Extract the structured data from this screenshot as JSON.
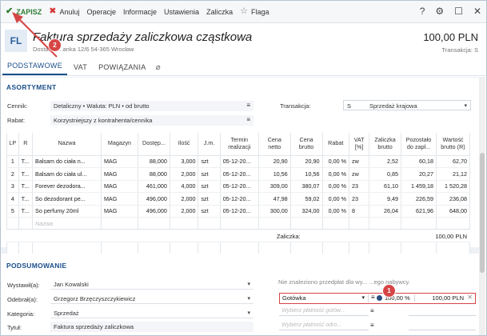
{
  "toolbar": {
    "save": "ZAPISZ",
    "cancel": "Anuluj",
    "items": [
      "Operacje",
      "Informacje",
      "Ustawienia",
      "Zaliczka"
    ],
    "flag": "Flaga",
    "right_icons": [
      "help-icon",
      "gear-icon",
      "maximize-icon",
      "close-icon"
    ]
  },
  "header": {
    "avatar": "FL",
    "title": "Faktura sprzedaży zaliczkowa cząstkowa",
    "subtitle": "Dostawa  ...anka  12/6  54-365  Wrocław",
    "amount": "100,00 PLN",
    "amount_sub": "Transakcja: S"
  },
  "tabs": [
    "PODSTAWOWE",
    "VAT",
    "POWIĄZANIA"
  ],
  "assortment": {
    "title": "ASORTYMENT",
    "cennik_label": "Cennik:",
    "cennik_value": "Detaliczny • Waluta: PLN • od brutto",
    "rabat_label": "Rabat:",
    "rabat_value": "Korzystniejszy z kontrahenta/cennika",
    "transakcja_label": "Transakcja:",
    "transakcja_code": "S",
    "transakcja_value": "Sprzedaż krajowa"
  },
  "table": {
    "headers": [
      "LP",
      "R",
      "Nazwa",
      "Magazyn",
      "Dostęp...",
      "Ilość",
      "J.m.",
      "Termin realizacji",
      "Cena netto",
      "Cena brutto",
      "Rabat",
      "VAT [%]",
      "Zaliczka brutto",
      "Pozostało do zapł...",
      "Wartość brutto (R)"
    ],
    "rows": [
      [
        "1",
        "T...",
        "Balsam do ciała n...",
        "MAG",
        "88,000",
        "3,000",
        "szt",
        "05-12-20...",
        "20,90",
        "20,90",
        "0,00 %",
        "zw",
        "2,52",
        "60,18",
        "62,70"
      ],
      [
        "2",
        "T...",
        "Balsam do ciała ul...",
        "MAG",
        "88,000",
        "2,000",
        "szt",
        "05-12-20...",
        "10,56",
        "10,56",
        "0,00 %",
        "zw",
        "0,85",
        "20,27",
        "21,12"
      ],
      [
        "3",
        "T...",
        "Forever dezodora...",
        "MAG",
        "461,000",
        "4,000",
        "szt",
        "05-12-20...",
        "309,00",
        "380,07",
        "0,00 %",
        "23",
        "61,10",
        "1 459,18",
        "1 520,28"
      ],
      [
        "4",
        "T...",
        "So dezodorant pe...",
        "MAG",
        "496,000",
        "2,000",
        "szt",
        "05-12-20...",
        "47,98",
        "59,02",
        "0,00 %",
        "23",
        "9,49",
        "226,59",
        "236,08"
      ],
      [
        "5",
        "T...",
        "So perfumy 20ml",
        "MAG",
        "496,000",
        "2,000",
        "szt",
        "05-12-20...",
        "300,00",
        "324,00",
        "0,00 %",
        "8",
        "26,04",
        "621,96",
        "648,00"
      ]
    ],
    "placeholder": "Nazwa"
  },
  "zaliczka": {
    "label": "Zaliczka:",
    "value": "100,00 PLN"
  },
  "summary": {
    "title": "PODSUMOWANIE",
    "wystawil_label": "Wystawił(a):",
    "wystawil_value": "Jan Kowalski",
    "odebral_label": "Odebrał(a):",
    "odebral_value": "Grzegorz Brzęczyszczykiewicz",
    "kategoria_label": "Kategoria:",
    "kategoria_value": "Sprzedaż",
    "tytul_label": "Tytuł:",
    "tytul_value": "Faktura sprzedaży zaliczkowa",
    "note": "Nie znaleziono przedpłat dla wy... ...ego nabywcy.",
    "payment_method": "Gotówka",
    "payment_percent": "100,00 %",
    "payment_amount": "100,00 PLN",
    "payment_placeholder_1": "Wybierz płatność gotów...",
    "payment_placeholder_2": "Wybierz płatność odro..."
  },
  "annotations": {
    "badge_1": "1",
    "badge_2": "2"
  },
  "colors": {
    "accent": "#1b4f8a",
    "save": "#2e7d32",
    "highlight": "#d64545"
  }
}
